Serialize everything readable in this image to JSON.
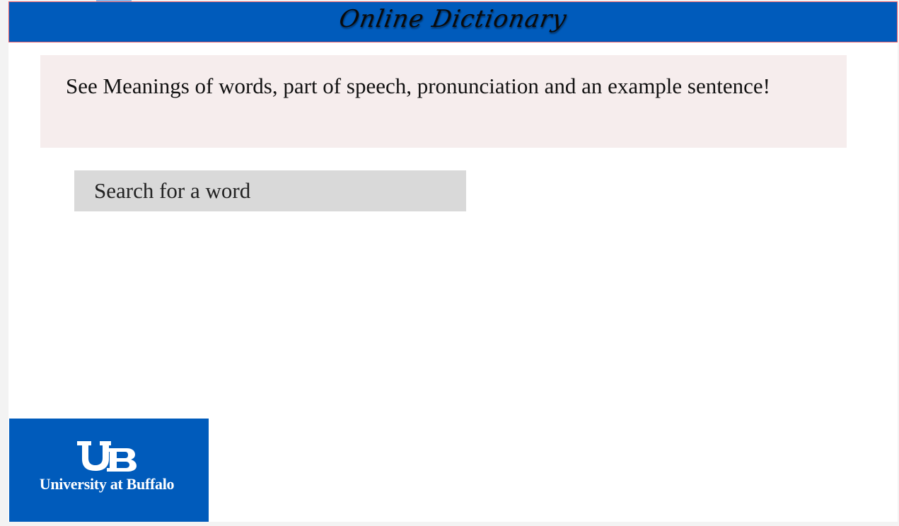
{
  "header": {
    "title": "Online Dictionary",
    "background_color": "#005bbb"
  },
  "intro": {
    "text": "See Meanings of words, part of speech, pronunciation and an example sentence!",
    "background_color": "#f6eded"
  },
  "search": {
    "placeholder": "Search for a word",
    "value": ""
  },
  "logo": {
    "icon": "ub-logo-icon",
    "text": "University at Buffalo",
    "background_color": "#005bbb"
  }
}
